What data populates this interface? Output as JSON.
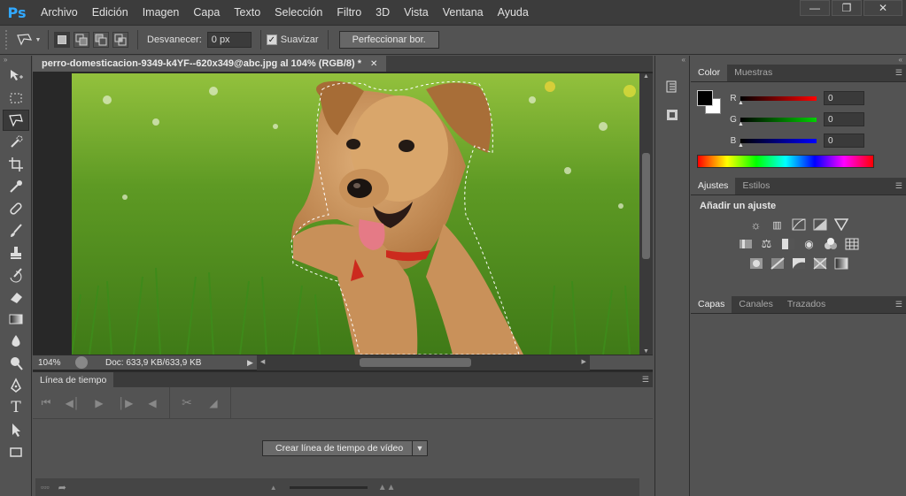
{
  "app": {
    "logo": "Ps"
  },
  "menu": [
    "Archivo",
    "Edición",
    "Imagen",
    "Capa",
    "Texto",
    "Selección",
    "Filtro",
    "3D",
    "Vista",
    "Ventana",
    "Ayuda"
  ],
  "options": {
    "feather_label": "Desvanecer:",
    "feather_value": "0 px",
    "smooth_label": "Suavizar",
    "smooth_checked": true,
    "refine_label": "Perfeccionar bor."
  },
  "document": {
    "tab_title": "perro-domesticacion-9349-k4YF--620x349@abc.jpg al 104% (RGB/8) *",
    "zoom": "104%",
    "doc_info": "Doc: 633,9 KB/633,9 KB"
  },
  "timeline": {
    "tab": "Línea de tiempo",
    "create_button": "Crear línea de tiempo de vídeo"
  },
  "color_panel": {
    "tabs": [
      "Color",
      "Muestras"
    ],
    "channels": [
      {
        "label": "R",
        "value": "0",
        "color": "#ff0000"
      },
      {
        "label": "G",
        "value": "0",
        "color": "#00d000"
      },
      {
        "label": "B",
        "value": "0",
        "color": "#0000ff"
      }
    ]
  },
  "adjust_panel": {
    "tabs": [
      "Ajustes",
      "Estilos"
    ],
    "heading": "Añadir un ajuste"
  },
  "layers_panel": {
    "tabs": [
      "Capas",
      "Canales",
      "Trazados"
    ]
  },
  "tools": [
    "move-tool",
    "marquee-tool",
    "polygon-lasso-tool",
    "quick-select-tool",
    "crop-tool",
    "eyedropper-tool",
    "healing-tool",
    "brush-tool",
    "stamp-tool",
    "history-brush-tool",
    "eraser-tool",
    "gradient-tool",
    "blur-tool",
    "dodge-tool",
    "pen-tool",
    "type-tool",
    "path-select-tool",
    "shape-tool"
  ]
}
